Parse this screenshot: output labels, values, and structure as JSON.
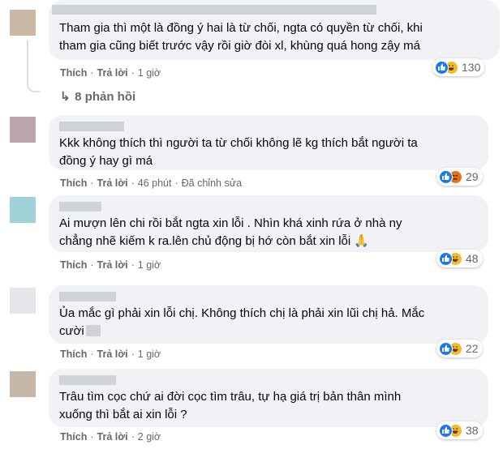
{
  "comments": [
    {
      "avatar_color": "#c9b8a3",
      "lines": [
        "Tham gia thì một là đồng ý hai là từ chối, ngta có quyền từ chối, khi",
        "tham gia cũng biết trước vậy rồi giờ đòi xl, khùng quá hong zậy má"
      ],
      "like": "Thích",
      "reply": "Trả lời",
      "time": "1 giờ",
      "edited": "",
      "reactions": [
        "like",
        "haha"
      ],
      "count": "130"
    },
    {
      "avatar_color": "#bda7ae",
      "lines": [
        "Kkk không thích thì người ta từ chối không lẽ kg thích bắt người ta",
        "đồng ý hay gì má"
      ],
      "like": "Thích",
      "reply": "Trả lời",
      "time": "46 phút",
      "edited": "Đã chỉnh sửa",
      "reactions": [
        "like",
        "angry"
      ],
      "count": "29"
    },
    {
      "avatar_color": "#9fd1d6",
      "lines": [
        "Ai mượn lên chi rồi bắt ngta xin lỗi . Nhìn khá xinh rứa ở nhà ny",
        "chẳng nhẽ kiếm k ra.lên chủ động bị hớ còn bắt xin lỗi 🙏"
      ],
      "like": "Thích",
      "reply": "Trả lời",
      "time": "1 giờ",
      "edited": "",
      "reactions": [
        "like",
        "haha"
      ],
      "count": "48"
    },
    {
      "avatar_color": "#e4e6e9",
      "lines": [
        "Ủa mắc gì phải xin lỗi chị. Không thích chị là phải xin lũi chị hả. Mắc",
        "cười"
      ],
      "like": "Thích",
      "reply": "Trả lời",
      "time": "1 giờ",
      "edited": "",
      "reactions": [
        "like",
        "haha"
      ],
      "count": "22"
    },
    {
      "avatar_color": "#c6b7a9",
      "lines": [
        "Trâu tìm cọc chứ ai đời cọc tìm trâu, tự hạ giá trị bản thân mình",
        "xuống thì bắt ai xin lỗi ?"
      ],
      "like": "Thích",
      "reply": "Trả lời",
      "time": "2 giờ",
      "edited": "",
      "reactions": [
        "like",
        "haha"
      ],
      "count": "38"
    }
  ],
  "replies_link": "8 phản hồi",
  "separator": "·"
}
